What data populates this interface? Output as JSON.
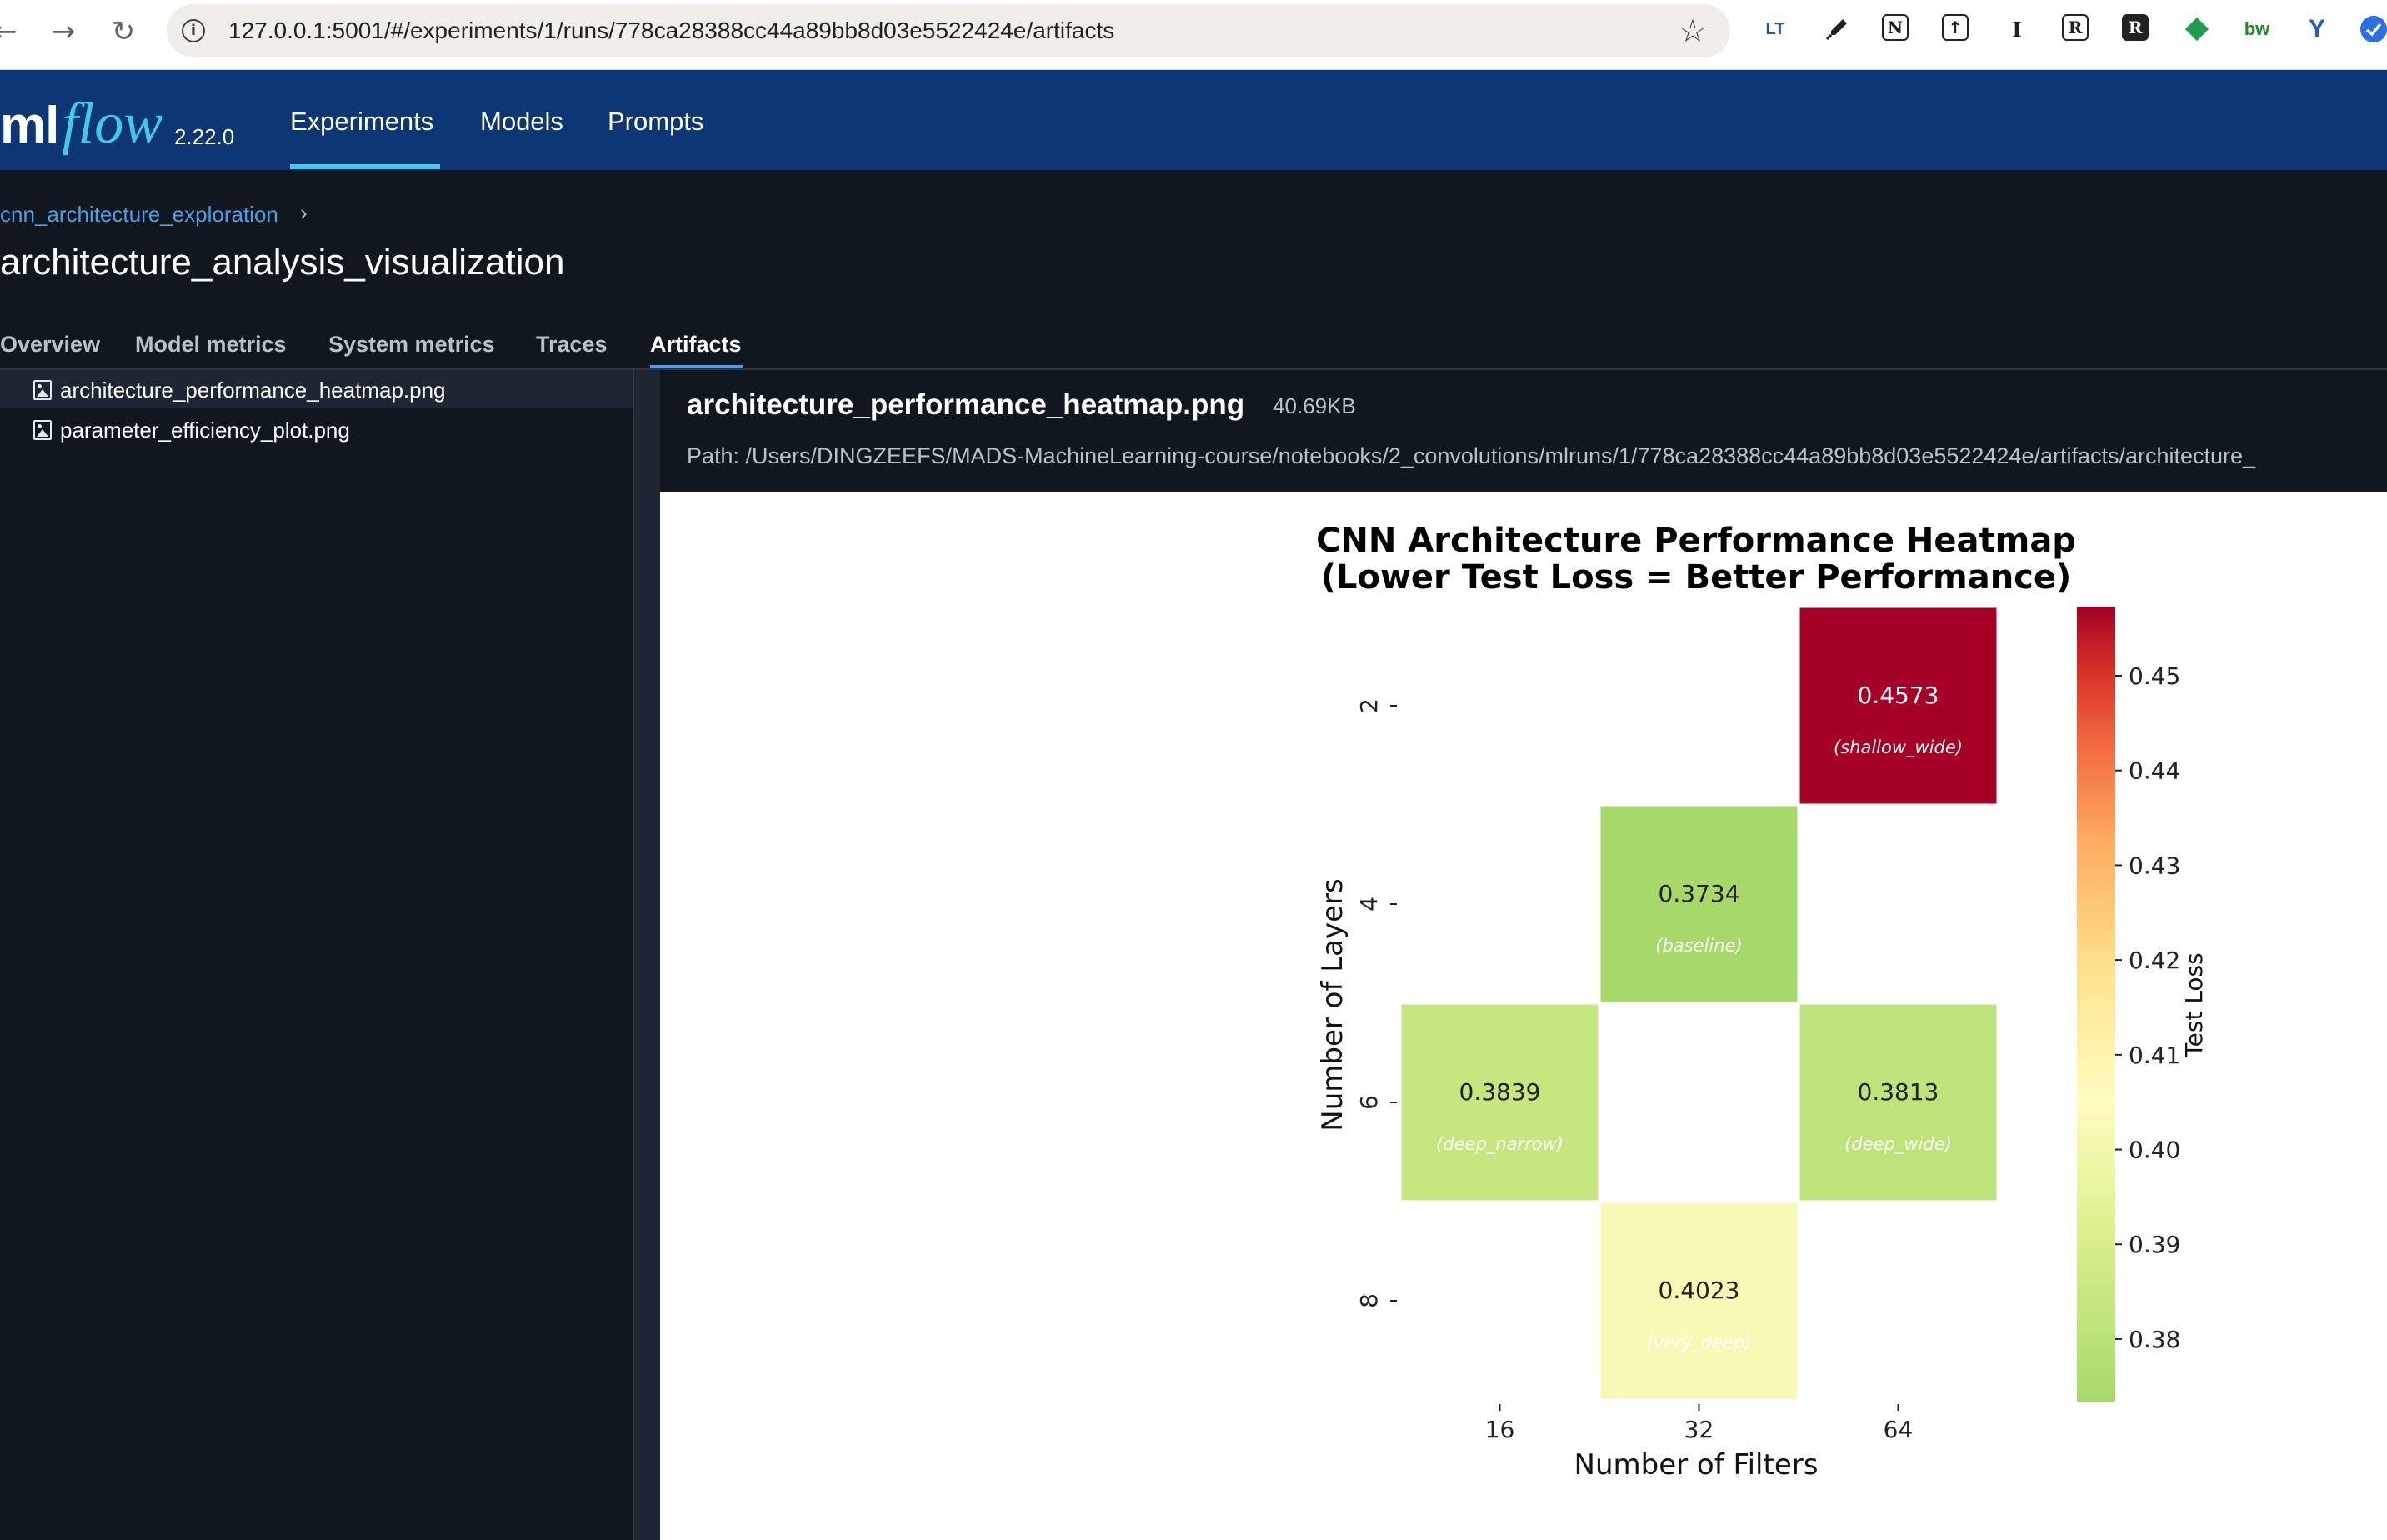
{
  "browser": {
    "url": "127.0.0.1:5001/#/experiments/1/runs/778ca28388cc44a89bb8d03e5522424e/artifacts",
    "back_label": "←",
    "forward_label": "→",
    "reload_label": "↻",
    "info_label": "i",
    "star_label": "☆",
    "extensions": [
      "LT",
      "eyedropper",
      "N",
      "upload",
      "I",
      "R",
      "R",
      "diamond",
      "bw",
      "Y",
      "other"
    ]
  },
  "header": {
    "logo_ml": "ml",
    "logo_flow": "flow",
    "version": "2.22.0",
    "nav": [
      "Experiments",
      "Models",
      "Prompts"
    ],
    "active_nav": "Experiments"
  },
  "page": {
    "breadcrumb": "cnn_architecture_exploration",
    "breadcrumb_chevron": "›",
    "title": "architecture_analysis_visualization",
    "tabs": [
      "Overview",
      "Model metrics",
      "System metrics",
      "Traces",
      "Artifacts"
    ],
    "active_tab": "Artifacts"
  },
  "files": [
    {
      "name": "architecture_performance_heatmap.png",
      "selected": true
    },
    {
      "name": "parameter_efficiency_plot.png",
      "selected": false
    }
  ],
  "artifact": {
    "name": "architecture_performance_heatmap.png",
    "size": "40.69KB",
    "path": "Path: /Users/DINGZEEFS/MADS-MachineLearning-course/notebooks/2_convolutions/mlruns/1/778ca28388cc44a89bb8d03e5522424e/artifacts/architecture_"
  },
  "colors": {
    "header_bg": "#0d3675",
    "accent": "#43c9ed",
    "link": "#4b9fe6",
    "page_bg": "#11171f"
  },
  "chart_data": {
    "type": "heatmap",
    "title_line1": "CNN Architecture Performance Heatmap",
    "title_line2": "(Lower Test Loss = Better Performance)",
    "xlabel": "Number of Filters",
    "ylabel": "Number of Layers",
    "x_categories": [
      "16",
      "32",
      "64"
    ],
    "y_categories": [
      "2",
      "4",
      "6",
      "8"
    ],
    "cells": [
      {
        "layers": "2",
        "filters": "64",
        "value": 0.4573,
        "label": "0.4573",
        "name": "(shallow_wide)"
      },
      {
        "layers": "4",
        "filters": "32",
        "value": 0.3734,
        "label": "0.3734",
        "name": "(baseline)"
      },
      {
        "layers": "6",
        "filters": "16",
        "value": 0.3839,
        "label": "0.3839",
        "name": "(deep_narrow)"
      },
      {
        "layers": "6",
        "filters": "64",
        "value": 0.3813,
        "label": "0.3813",
        "name": "(deep_wide)"
      },
      {
        "layers": "8",
        "filters": "32",
        "value": 0.4023,
        "label": "0.4023",
        "name": "(very_deep)"
      }
    ],
    "colorbar": {
      "label": "Test Loss",
      "colormap": "RdYlGn_r",
      "range": [
        0.3734,
        0.4573
      ],
      "ticks": [
        "0.38",
        "0.39",
        "0.40",
        "0.41",
        "0.42",
        "0.43",
        "0.44",
        "0.45"
      ]
    }
  }
}
